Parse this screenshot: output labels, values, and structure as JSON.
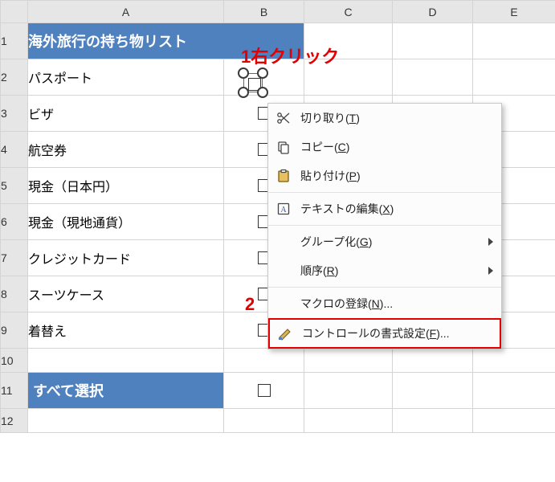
{
  "annotations": {
    "step1": "1右クリック",
    "step2": "2"
  },
  "columns": {
    "rowhdr": "",
    "A": "A",
    "B": "B",
    "C": "C",
    "D": "D",
    "E": "E"
  },
  "rows": {
    "r1_label": "1",
    "r2_label": "2",
    "r3_label": "3",
    "r4_label": "4",
    "r5_label": "5",
    "r6_label": "6",
    "r7_label": "7",
    "r8_label": "8",
    "r9_label": "9",
    "r10_label": "10",
    "r11_label": "11",
    "r12_label": "12"
  },
  "cells": {
    "title": "海外旅行の持ち物リスト",
    "r2": "パスポート",
    "r3": "ビザ",
    "r4": "航空券",
    "r5": "現金（日本円）",
    "r6": "現金（現地通貨）",
    "r7": "クレジットカード",
    "r8": "スーツケース",
    "r9": "着替え",
    "r11": "すべて選択"
  },
  "context_menu": {
    "cut": {
      "label": "切り取り(",
      "accel": "T",
      "suffix": ")"
    },
    "copy": {
      "label": "コピー(",
      "accel": "C",
      "suffix": ")"
    },
    "paste": {
      "label": "貼り付け(",
      "accel": "P",
      "suffix": ")"
    },
    "edit_text": {
      "label": "テキストの編集(",
      "accel": "X",
      "suffix": ")"
    },
    "group": {
      "label": "グループ化(",
      "accel": "G",
      "suffix": ")"
    },
    "order": {
      "label": "順序(",
      "accel": "R",
      "suffix": ")"
    },
    "assign_macro": {
      "label": "マクロの登録(",
      "accel": "N",
      "suffix": ")..."
    },
    "format_control": {
      "label": "コントロールの書式設定(",
      "accel": "F",
      "suffix": ")..."
    }
  },
  "colors": {
    "header_blue": "#4e81bd",
    "annotation_red": "#e20000"
  }
}
